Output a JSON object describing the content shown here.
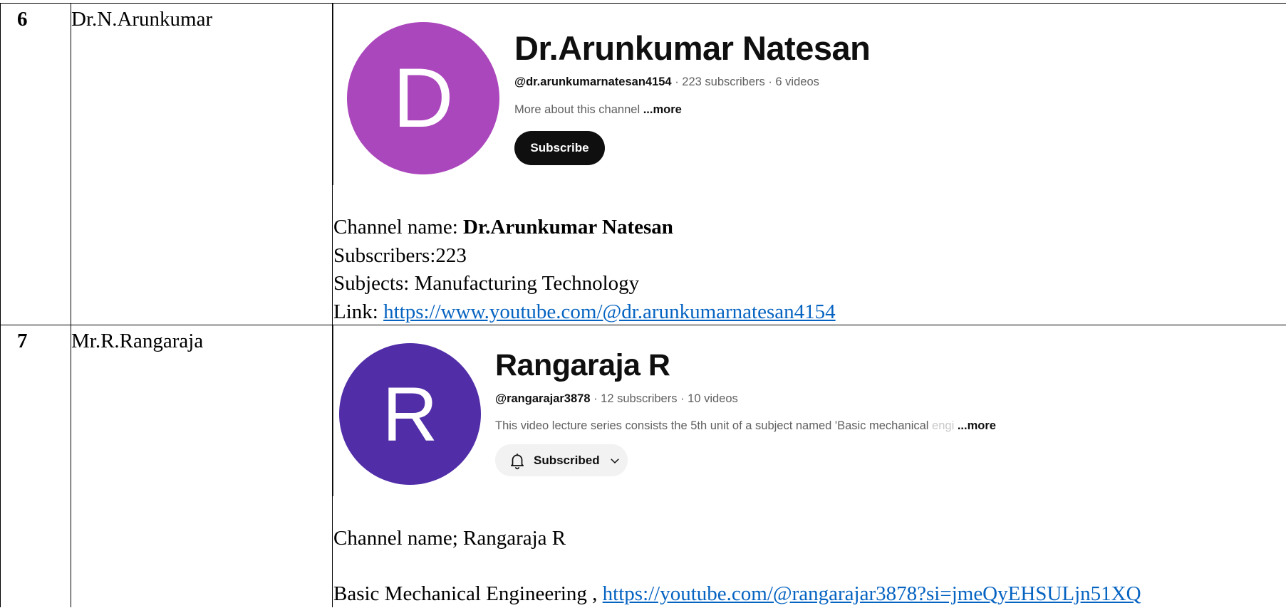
{
  "rows": [
    {
      "number": "6",
      "name": "Dr.N.Arunkumar",
      "channel_card": {
        "avatar_letter": "D",
        "avatar_color": "#ab47bc",
        "title": "Dr.Arunkumar Natesan",
        "handle": "@dr.arunkumarnatesan4154",
        "stats": " · 223 subscribers · 6 videos",
        "description": "More about this channel",
        "more_label": "...more",
        "button_label": "Subscribe"
      },
      "info": {
        "channel_prefix": "Channel name: ",
        "channel_name": "Dr.Arunkumar Natesan",
        "subscribers": "Subscribers:223",
        "subjects": "Subjects: Manufacturing Technology",
        "link_prefix": "Link: ",
        "link": "https://www.youtube.com/@dr.arunkumarnatesan4154"
      }
    },
    {
      "number": "7",
      "name": "Mr.R.Rangaraja",
      "channel_card": {
        "avatar_letter": "R",
        "avatar_color": "#512da8",
        "title": "Rangaraja R",
        "handle": "@rangarajar3878",
        "stats": " · 12 subscribers · 10 videos",
        "description": "This video lecture series consists the 5th unit of a subject named 'Basic mechanical ",
        "description_faded": "engi",
        "more_label": "...more",
        "button_label": "Subscribed"
      },
      "info": {
        "channel_name_line": "Channel name; Rangaraja R",
        "link_prefix": "Basic Mechanical Engineering , ",
        "link": "https://youtube.com/@rangarajar3878?si=jmeQyEHSULjn51XQ"
      }
    }
  ]
}
